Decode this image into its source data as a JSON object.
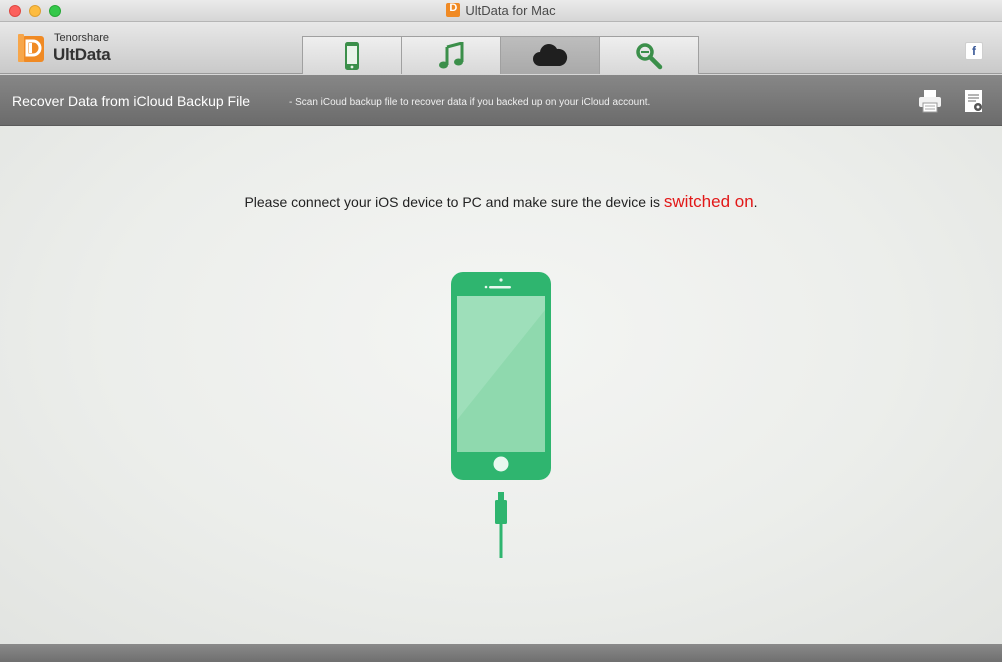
{
  "window": {
    "title": "UltData for Mac",
    "buttons": [
      "close",
      "minimize",
      "zoom"
    ]
  },
  "brand": {
    "company": "Tenorshare",
    "product": "UltData",
    "logo_icon": "ultdata-logo-icon",
    "accent_color": "#f08a24"
  },
  "tabs": [
    {
      "icon": "iphone-icon",
      "active": false
    },
    {
      "icon": "music-note-icon",
      "active": false
    },
    {
      "icon": "cloud-icon",
      "active": true
    },
    {
      "icon": "repair-tools-icon",
      "active": false
    }
  ],
  "toolbar": {
    "facebook_label": "f"
  },
  "header": {
    "title": "Recover Data from iCloud Backup File",
    "description": " - Scan iCoud backup file to recover data if you backed up on your iCloud account.",
    "icons": [
      "printer-icon",
      "document-settings-icon"
    ]
  },
  "main": {
    "instruction_text": "Please connect your iOS device to PC and make sure the device is ",
    "instruction_highlight": "switched on",
    "instruction_end": ".",
    "highlight_color": "#e21818",
    "illustration": "iphone-with-cable-icon",
    "illustration_color": "#2fb56f"
  }
}
